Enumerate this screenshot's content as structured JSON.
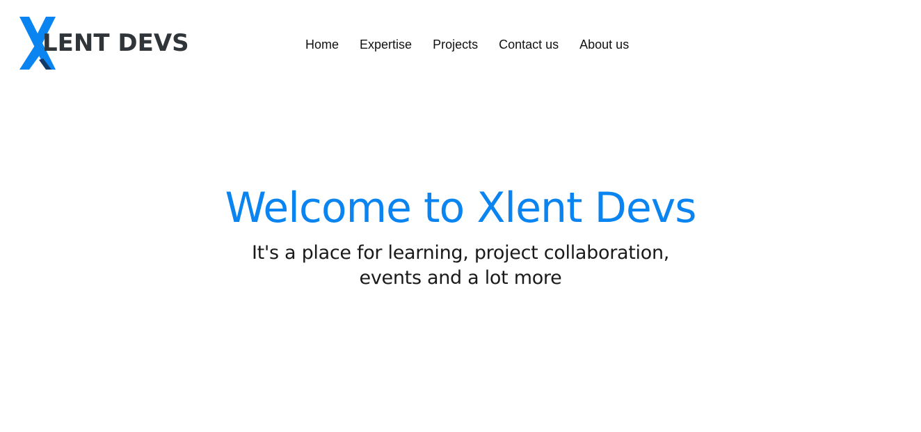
{
  "header": {
    "logo": {
      "text": "LENT DEVS",
      "full_name": "XLENT DEVS",
      "mark_icon": "x-logo-mark",
      "colors": {
        "mark_primary": "#0a84f0",
        "mark_secondary": "#123a66",
        "text": "#30353a"
      }
    },
    "nav": {
      "items": [
        {
          "label": "Home"
        },
        {
          "label": "Expertise"
        },
        {
          "label": "Projects"
        },
        {
          "label": "Contact us"
        },
        {
          "label": "About us"
        }
      ]
    }
  },
  "hero": {
    "title": "Welcome to Xlent Devs",
    "subtitle_line1": "It's a place for learning, project collaboration,",
    "subtitle_line2": "events and a lot more",
    "colors": {
      "title": "#0a84f0",
      "subtitle": "#1a1a1a"
    }
  }
}
